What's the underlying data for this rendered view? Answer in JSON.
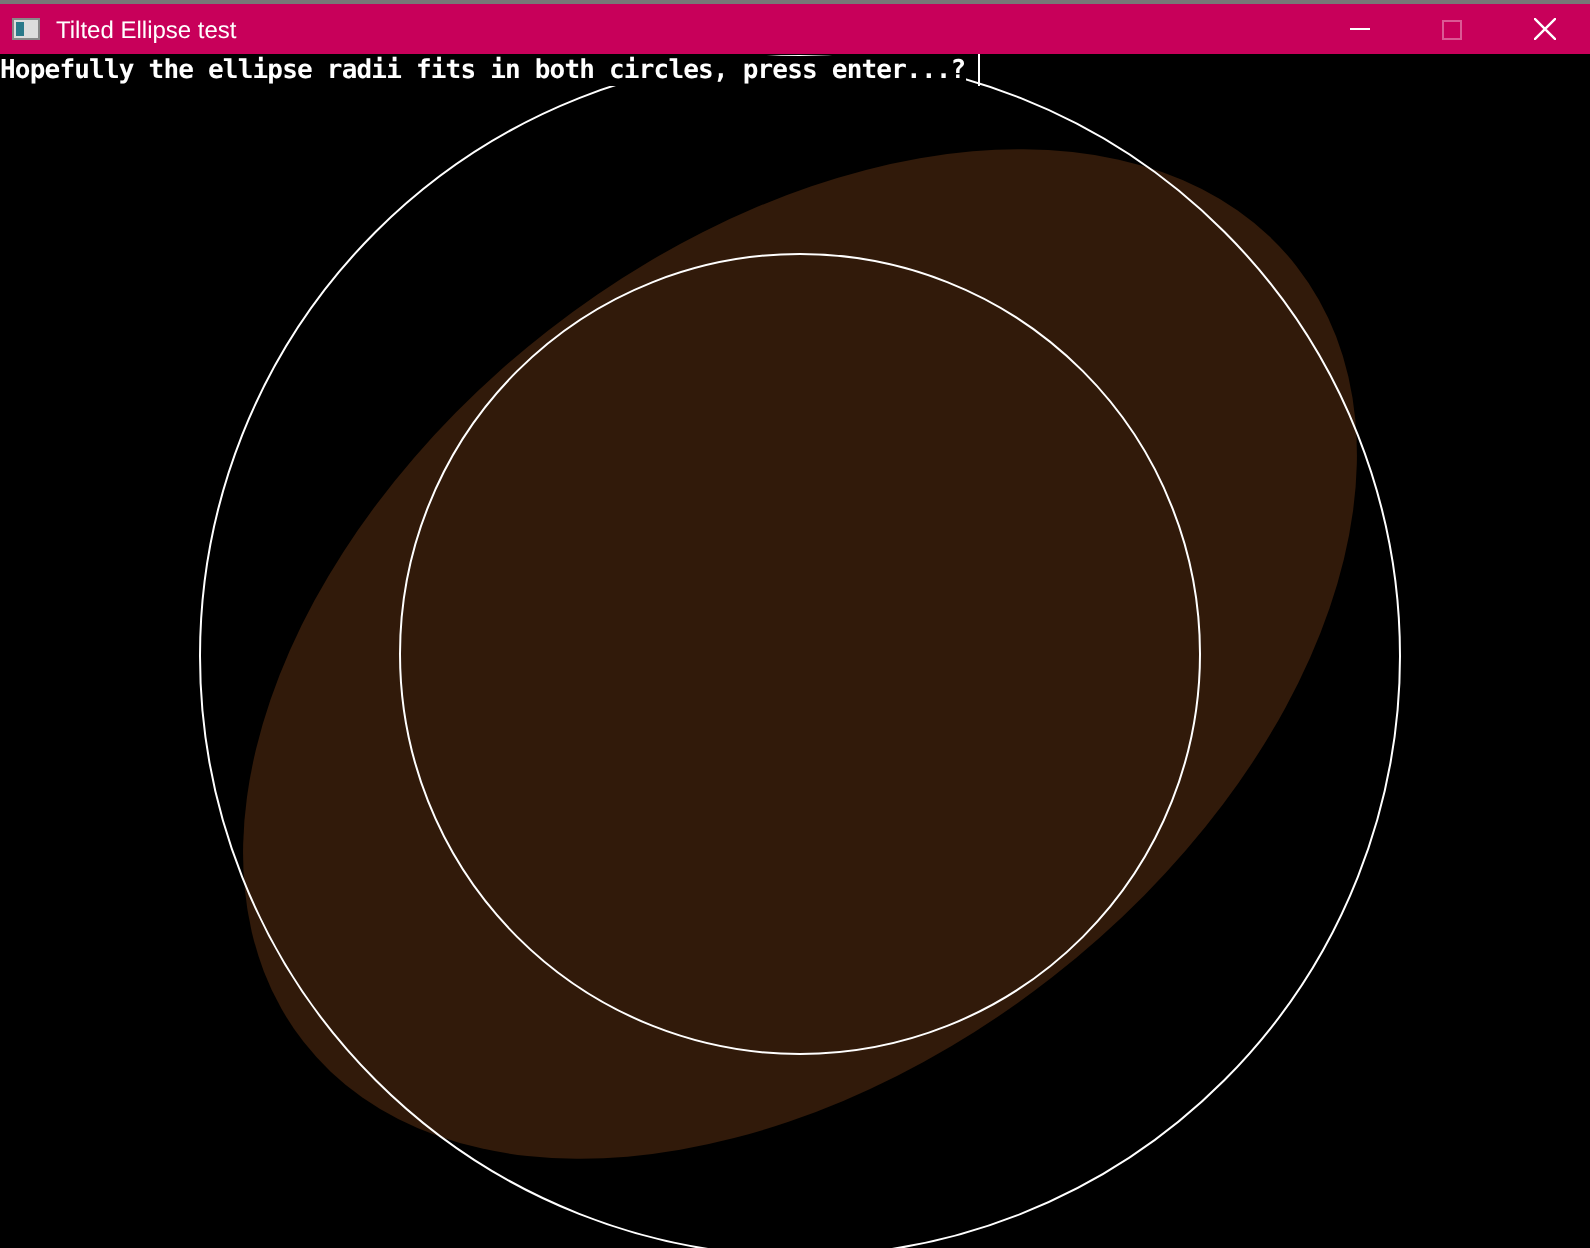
{
  "window": {
    "title": "Tilted Ellipse test",
    "maximize_disabled": true
  },
  "console": {
    "prompt": "Hopefully the ellipse radii fits in both circles, press enter...?",
    "cursor_visible": true
  }
}
